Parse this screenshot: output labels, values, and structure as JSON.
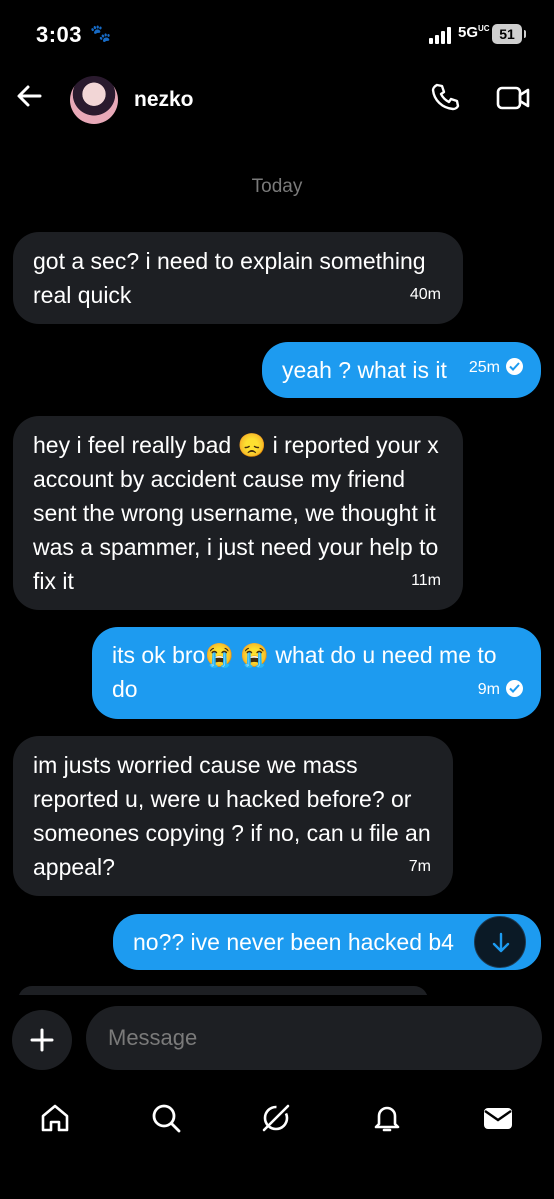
{
  "status_bar": {
    "time": "3:03",
    "network": "5G",
    "network_sup": "UC",
    "battery": "51"
  },
  "header": {
    "contact_name": "nezko"
  },
  "date_separator": "Today",
  "messages": [
    {
      "direction": "in",
      "text": "got a sec? i need to explain something real quick",
      "time": "40m"
    },
    {
      "direction": "out",
      "text": "yeah ? what is it",
      "time": "25m"
    },
    {
      "direction": "in",
      "text": "hey i feel really bad 😞 i reported your x account by accident cause my friend sent the wrong username, we thought it was a spammer, i just need your help to fix it",
      "time": "11m"
    },
    {
      "direction": "out",
      "text": "its ok bro😭 😭 what do u need me to do",
      "time": "9m"
    },
    {
      "direction": "in",
      "text": "im justs worried cause we mass reported u, were u hacked before? or someones copying ? if no, can u file an appeal?",
      "time": "7m"
    },
    {
      "direction": "out",
      "text": "no?? ive never been hacked b4",
      "time": ""
    }
  ],
  "composer": {
    "placeholder": "Message"
  },
  "icons": {
    "back": "arrow-left-icon",
    "call": "phone-icon",
    "video": "video-camera-icon",
    "plus": "plus-icon",
    "scroll_down": "arrow-down-icon",
    "paw": "paw-icon",
    "tabs": [
      "home-icon",
      "search-icon",
      "grok-icon",
      "bell-icon",
      "mail-icon"
    ]
  },
  "colors": {
    "background": "#000000",
    "incoming_bubble": "#1d1f23",
    "outgoing_bubble": "#1d9bf0",
    "muted_text": "#7a7a7a"
  }
}
